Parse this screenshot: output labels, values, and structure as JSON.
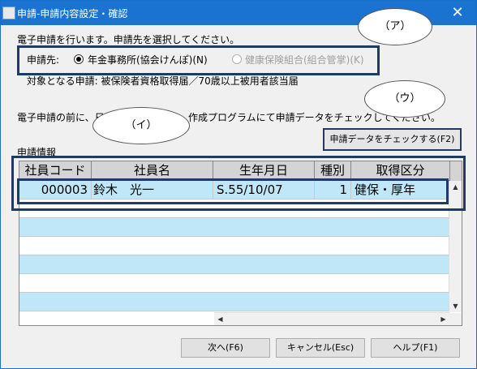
{
  "window": {
    "title": "申請-申請内容設定・確認",
    "close_glyph": "✕"
  },
  "intro_text": "電子申請を行います。申請先を選択してください。",
  "destination": {
    "label": "申請先:",
    "options": [
      {
        "label": "年金事務所(協会けんぽ)(N)",
        "selected": true,
        "enabled": true
      },
      {
        "label": "健康保険組合(組合管掌)(K)",
        "selected": false,
        "enabled": false
      }
    ]
  },
  "target_text": "対象となる申請: 被保険者資格取得届／70歳以上被用者該当届",
  "check_text_left": "電子申請の前に、日本",
  "check_text_right": "作成プログラムにて申請データをチェックしてください。",
  "check_button_label": "申請データをチェックする(F2)",
  "section_label": "申請情報",
  "callouts": {
    "a": "（ア）",
    "i": "（イ）",
    "u": "（ウ）"
  },
  "table": {
    "columns": [
      "社員コード",
      "社員名",
      "生年月日",
      "種別",
      "取得区分"
    ],
    "rows": [
      {
        "code": "000003",
        "name": "鈴木　光一",
        "birth": "S.55/10/07",
        "type": "1",
        "category": "健保・厚年"
      }
    ]
  },
  "buttons": {
    "next": "次へ(F6)",
    "cancel": "キャンセル(Esc)",
    "help": "ヘルプ(F1)"
  },
  "colors": {
    "titlebar": "#1a73d1",
    "row_highlight": "#bfe7f7",
    "frame": "#1f3a64"
  }
}
